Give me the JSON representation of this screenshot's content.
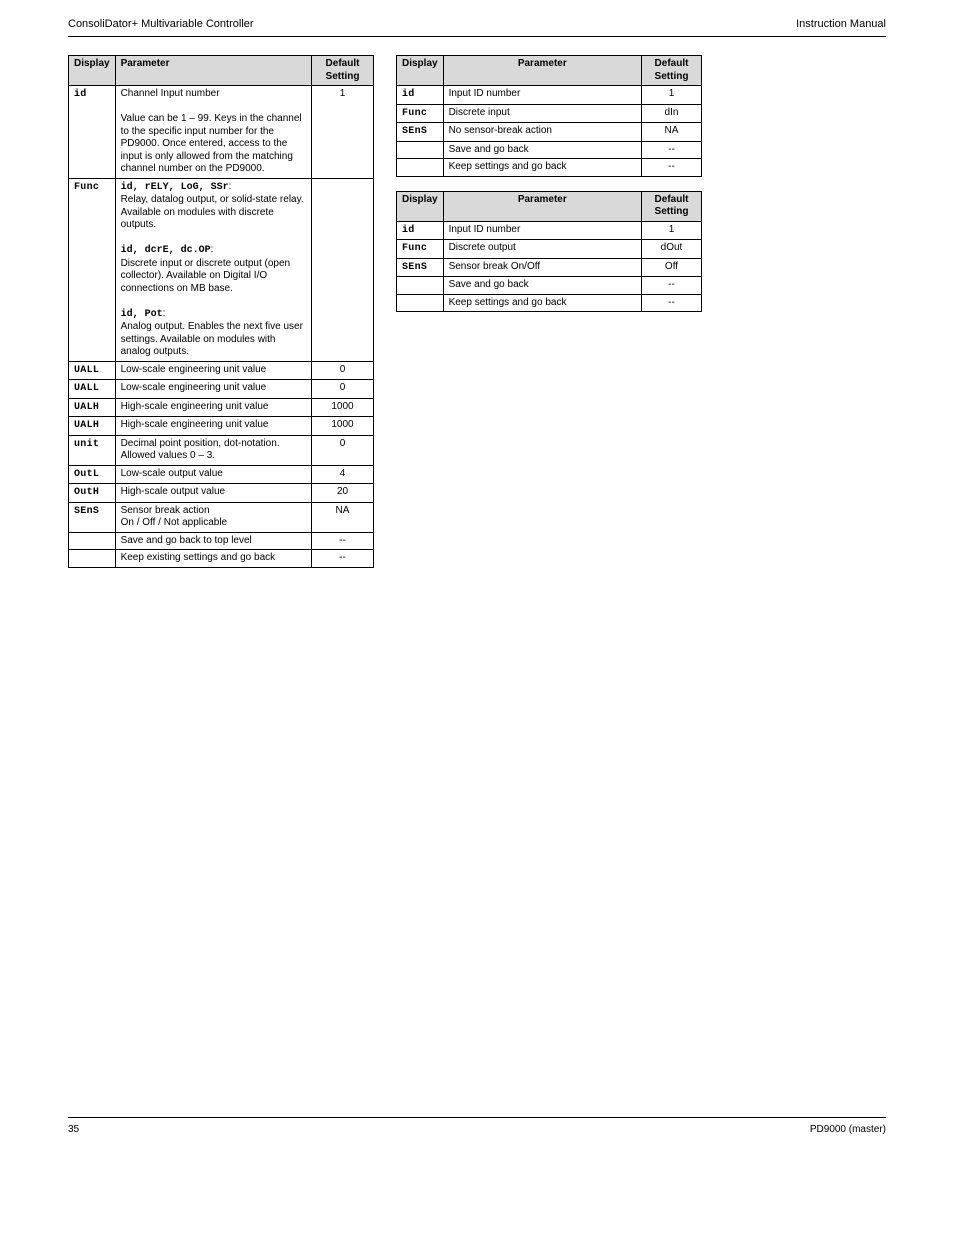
{
  "header": {
    "left": "ConsoliDator+ Multivariable Controller",
    "right": "Instruction Manual"
  },
  "footer": {
    "left": "35",
    "right": "PD9000 (master)"
  },
  "tables": {
    "advanced": {
      "cols": [
        "Display",
        "Parameter",
        "Default Setting"
      ],
      "rows": [
        {
          "display": "id",
          "seg": true,
          "param_html": "Channel Input number<br><br>Value can be 1 – 99. Keys in the channel to the specific input number for the PD9000. Once entered, access to the input is only allowed from the matching channel number on the PD9000.",
          "setting": "1"
        },
        {
          "display": "Func",
          "seg": true,
          "param_html": "<span style='font-family:\"Courier New\",monospace;font-weight:bold'>id, rELY, LoG, SSr</span>:<br>Relay, datalog output, or solid-state relay. Available on modules with discrete outputs.<br><br><span style='font-family:\"Courier New\",monospace;font-weight:bold'>id, dcrE, dc.OP</span>:<br>Discrete input or discrete output (open collector). Available on Digital I/O connections on MB base.<br><br><span style='font-family:\"Courier New\",monospace;font-weight:bold'>id, Pot</span>:<br>Analog output. Enables the next five user settings. Available on modules with analog outputs.",
          "setting": ""
        },
        {
          "display": "UALL",
          "seg": true,
          "param_html": "Low-scale engineering unit value",
          "setting": "0"
        },
        {
          "display": "UALL",
          "seg": true,
          "param_html": "Low-scale engineering unit value",
          "setting": "0"
        },
        {
          "display": "UALH",
          "seg": true,
          "param_html": "High-scale engineering unit value",
          "setting": "1000"
        },
        {
          "display": "UALH",
          "seg": true,
          "param_html": "High-scale engineering unit value",
          "setting": "1000"
        },
        {
          "display": "unit",
          "seg": true,
          "param_html": "Decimal point position, dot-notation. Allowed values 0 – 3.",
          "setting": "0"
        },
        {
          "display": "OutL",
          "seg": true,
          "param_html": "Low-scale output value",
          "setting": "4"
        },
        {
          "display": "OutH",
          "seg": true,
          "param_html": "High-scale output value",
          "setting": "20"
        },
        {
          "display": "SEnS",
          "seg": true,
          "param_html": "Sensor break action<br>On / Off / Not applicable",
          "setting": "NA"
        },
        {
          "display": "",
          "seg": false,
          "param_html": "Save and go back to top level",
          "setting": "--"
        },
        {
          "display": "",
          "seg": false,
          "param_html": "Keep existing settings and go back",
          "setting": "--"
        }
      ]
    },
    "discrete_in": {
      "caption_cols": [
        "Display",
        "Parameter",
        "Default Setting"
      ],
      "rows": [
        {
          "display": "id",
          "seg": true,
          "param": "Input ID number",
          "setting": "1"
        },
        {
          "display": "Func",
          "seg": true,
          "param": "Discrete input",
          "setting": "dIn"
        },
        {
          "display": "SEnS",
          "seg": true,
          "param": "No sensor-break action",
          "setting": "NA"
        },
        {
          "display": "",
          "seg": false,
          "param": "Save and go back",
          "setting": "--"
        },
        {
          "display": "",
          "seg": false,
          "param": "Keep settings and go back",
          "setting": "--"
        }
      ]
    },
    "discrete_out": {
      "caption_cols": [
        "Display",
        "Parameter",
        "Default Setting"
      ],
      "rows": [
        {
          "display": "id",
          "seg": true,
          "param": "Input ID number",
          "setting": "1"
        },
        {
          "display": "Func",
          "seg": true,
          "param": "Discrete output",
          "setting": "dOut"
        },
        {
          "display": "SEnS",
          "seg": true,
          "param": "Sensor break On/Off",
          "setting": "Off"
        },
        {
          "display": "",
          "seg": false,
          "param": "Save and go back",
          "setting": "--"
        },
        {
          "display": "",
          "seg": false,
          "param": "Keep settings and go back",
          "setting": "--"
        }
      ]
    }
  }
}
